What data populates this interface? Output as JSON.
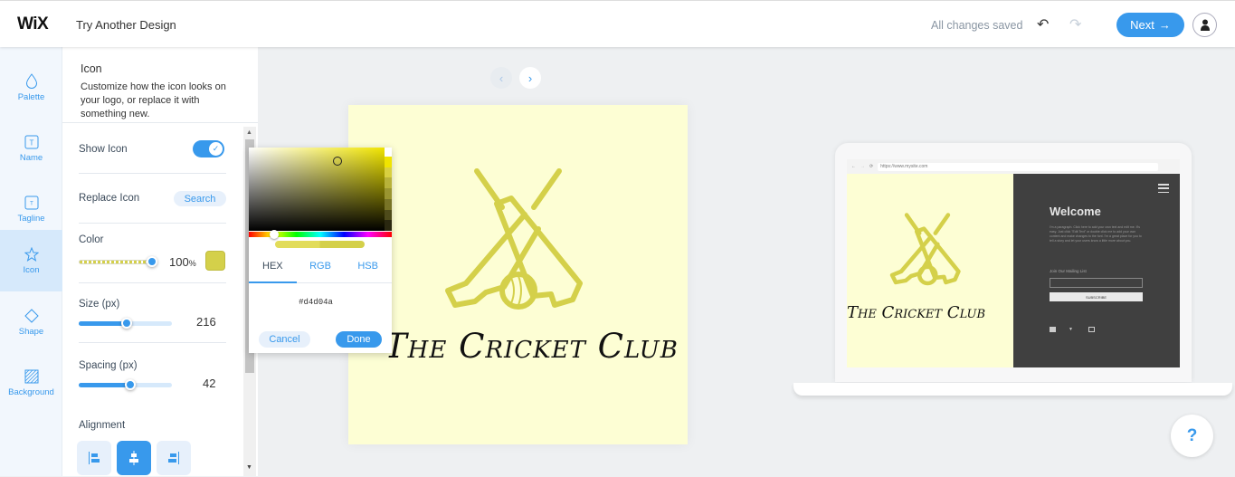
{
  "topbar": {
    "logo": "WiX",
    "title": "Try Another Design",
    "status": "All changes saved",
    "undo_icon": "↶",
    "redo_icon": "↷",
    "next_label": "Next",
    "next_arrow": "→"
  },
  "leftnav": {
    "items": [
      {
        "label": "Palette",
        "icon": "droplet-icon"
      },
      {
        "label": "Name",
        "icon": "text-icon"
      },
      {
        "label": "Tagline",
        "icon": "text-small-icon"
      },
      {
        "label": "Icon",
        "icon": "star-icon",
        "active": true
      },
      {
        "label": "Shape",
        "icon": "diamond-icon"
      },
      {
        "label": "Background",
        "icon": "hatched-square-icon"
      }
    ]
  },
  "panel": {
    "title": "Icon",
    "description": "Customize how the icon looks on your logo, or replace it with something new.",
    "show_icon": {
      "label": "Show Icon",
      "value": true
    },
    "replace_icon": {
      "label": "Replace Icon",
      "button": "Search"
    },
    "color": {
      "label": "Color",
      "opacity": 100,
      "opacity_text": "100",
      "unit": "%",
      "value": "#d4d04a"
    },
    "size": {
      "label": "Size (px)",
      "value": "216",
      "fraction": 0.51
    },
    "spacing": {
      "label": "Spacing (px)",
      "value": "42",
      "fraction": 0.55
    },
    "alignment": {
      "label": "Alignment",
      "options": [
        "left",
        "center",
        "right"
      ],
      "selected": "center"
    }
  },
  "color_picker": {
    "tabs": [
      "HEX",
      "RGB",
      "HSB"
    ],
    "active_tab": "HEX",
    "hex_value": "#d4d04a",
    "cancel_label": "Cancel",
    "done_label": "Done",
    "shades": [
      "#f0e400",
      "#d8d040",
      "#b8b23a",
      "#9a9530",
      "#787426",
      "#4e4b1a",
      "#2a2810"
    ]
  },
  "canvas": {
    "prev_arrow": "‹",
    "next_arrow": "›",
    "brand_name": "The Cricket Club",
    "background": "#fdfed4",
    "icon_color": "#d4d04a"
  },
  "preview": {
    "url": "https://www.mysite.com",
    "welcome": "Welcome",
    "paragraph": "I'm a paragraph. Click here to add your own text and edit me. It's easy. Just click \"Edit Text\" or double click me to add your own content and make changes to the font. I'm a great place for you to tell a story and let your users know a little more about you.",
    "mailing_list": "Join Our Mailing List",
    "subscribe": "SUBSCRIBE",
    "brand_name": "The Cricket Club"
  },
  "help_label": "?"
}
